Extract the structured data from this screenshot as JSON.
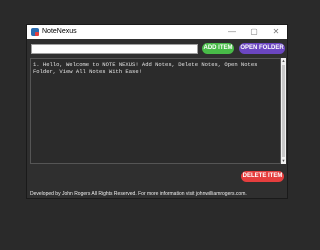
{
  "window": {
    "title": "NoteNexus",
    "controls": {
      "minimize": "—",
      "maximize": "▢",
      "close": "✕"
    }
  },
  "toolbar": {
    "search_value": "",
    "add_label": "ADD ITEM",
    "open_folder_label": "OPEN FOLDER"
  },
  "notes": {
    "text": "1. Hello, Welcome to NOTE NEXUS! Add Notes, Delete Notes, Open Notes Folder, View All Notes With Ease!"
  },
  "scrollbar": {
    "up": "▲",
    "down": "▼"
  },
  "actions": {
    "delete_label": "DELETE ITEM"
  },
  "footer": {
    "text": "Developed by John Rogers All Rights Reserved.  For more information visit johnwilliamrogers.com."
  },
  "colors": {
    "add": "#48bb48",
    "open_folder": "#6b46c1",
    "delete": "#e53e3e"
  }
}
